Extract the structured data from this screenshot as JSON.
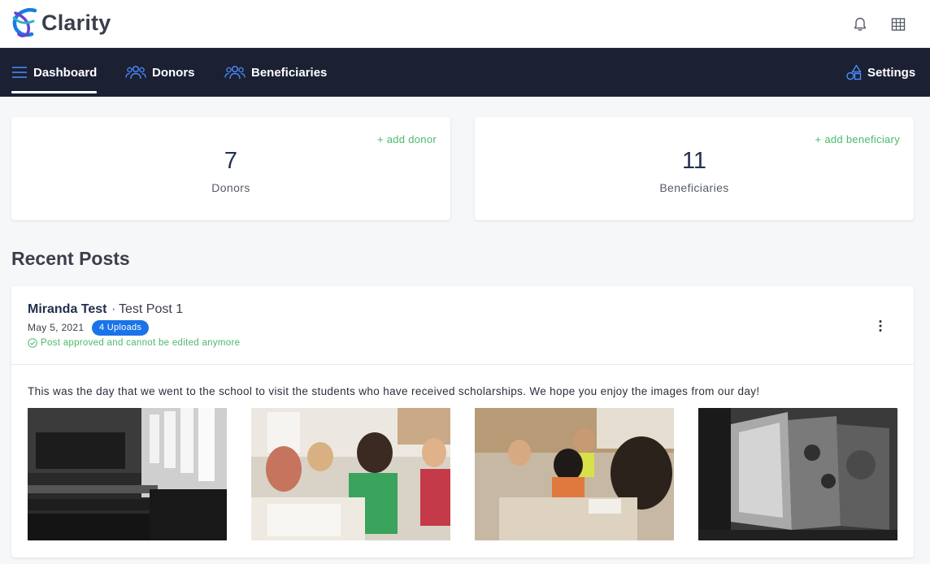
{
  "app": {
    "name": "Clarity"
  },
  "header": {
    "icons": [
      "bell-icon",
      "grid-icon"
    ]
  },
  "nav": {
    "items": [
      {
        "label": "Dashboard",
        "icon": "menu-icon",
        "active": true
      },
      {
        "label": "Donors",
        "icon": "people-icon",
        "active": false
      },
      {
        "label": "Beneficiaries",
        "icon": "people-icon",
        "active": false
      }
    ],
    "settings": {
      "label": "Settings",
      "icon": "shapes-icon"
    }
  },
  "stats": [
    {
      "add_label": "+ add donor",
      "count": "7",
      "label": "Donors"
    },
    {
      "add_label": "+ add beneficiary",
      "count": "11",
      "label": "Beneficiaries"
    }
  ],
  "recent_posts": {
    "title": "Recent Posts",
    "posts": [
      {
        "author": "Miranda Test",
        "separator": "·",
        "title": "Test Post 1",
        "date": "May 5, 2021",
        "uploads_badge": "4 Uploads",
        "status": "Post approved and cannot be edited anymore",
        "body": "This was the day that we went to the school to visit the students who have received scholarships. We hope you enjoy the images from our day!",
        "images": [
          "classroom-bw-photo",
          "children-writing-photo",
          "children-at-table-photo",
          "classroom-wall-bw-photo"
        ]
      }
    ]
  },
  "colors": {
    "nav_bg": "#1b2033",
    "accent_blue": "#1a73e8",
    "success_green": "#4cb86a",
    "text_dark": "#22304f"
  }
}
